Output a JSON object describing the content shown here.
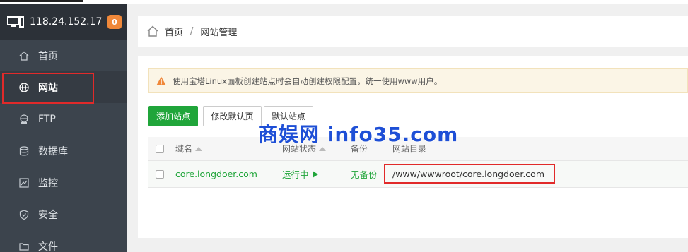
{
  "server": {
    "ip": "118.24.152.17",
    "badge_count": "0"
  },
  "sidebar": {
    "items": [
      {
        "label": "首页",
        "icon": "home-icon"
      },
      {
        "label": "网站",
        "icon": "globe-icon",
        "active": true
      },
      {
        "label": "FTP",
        "icon": "ftp-globe-icon"
      },
      {
        "label": "数据库",
        "icon": "database-icon"
      },
      {
        "label": "监控",
        "icon": "monitor-icon"
      },
      {
        "label": "安全",
        "icon": "shield-icon"
      },
      {
        "label": "文件",
        "icon": "folder-icon"
      }
    ]
  },
  "breadcrumb": {
    "home": "首页",
    "separator": "/",
    "current": "网站管理"
  },
  "notice": {
    "text": "使用宝塔Linux面板创建站点时会自动创建权限配置，统一使用www用户。"
  },
  "toolbar": {
    "add_site": "添加站点",
    "edit_default_page": "修改默认页",
    "default_site": "默认站点"
  },
  "table": {
    "headers": {
      "domain": "域名",
      "status": "网站状态",
      "backup": "备份",
      "root": "网站目录"
    },
    "rows": [
      {
        "domain": "core.longdoer.com",
        "status": "运行中",
        "backup": "无备份",
        "root": "/www/wwwroot/core.longdoer.com"
      }
    ]
  },
  "watermark": "商娱网 info35.com",
  "colors": {
    "sidebar_bg": "#3c444d",
    "accent_green": "#20a53a",
    "highlight_red": "#e12a2a",
    "badge_orange": "#f0883a",
    "watermark_blue": "#1e4fd6"
  }
}
